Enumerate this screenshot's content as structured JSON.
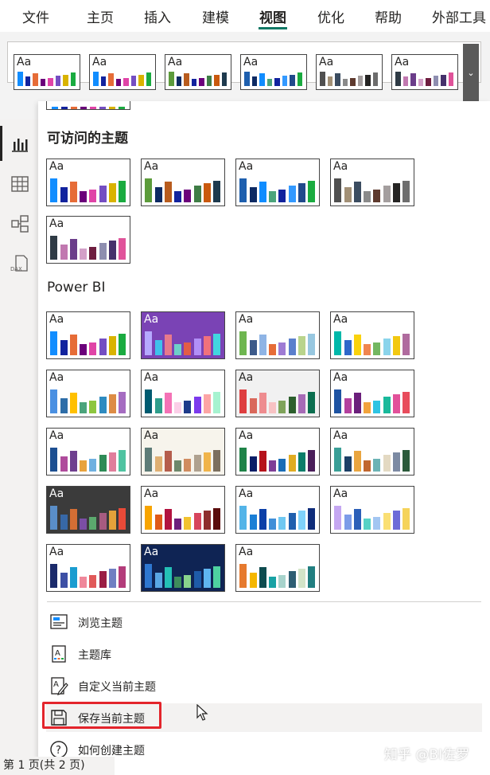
{
  "ribbon": {
    "tabs": [
      {
        "label": "文件"
      },
      {
        "label": "主页"
      },
      {
        "label": "插入"
      },
      {
        "label": "建模"
      },
      {
        "label": "视图",
        "active": true
      },
      {
        "label": "优化"
      },
      {
        "label": "帮助"
      },
      {
        "label": "外部工具"
      }
    ]
  },
  "thumb_label": "Aa",
  "accessible_section": {
    "title": "可访问的主题",
    "themes": [
      {
        "colors": [
          "#118DFF",
          "#12239E",
          "#E66C37",
          "#6B007B",
          "#E044A7",
          "#744EC2",
          "#D9B300",
          "#1AAB40"
        ],
        "bg": "#ffffff"
      },
      {
        "colors": [
          "#5C9B3B",
          "#0D2A63",
          "#B85C1E",
          "#12239E",
          "#6B007B",
          "#3F7D46",
          "#C9590E",
          "#1E3A4E"
        ],
        "bg": "#ffffff"
      },
      {
        "colors": [
          "#1E5FAE",
          "#0D2A63",
          "#118DFF",
          "#4BA47C",
          "#12239E",
          "#3399FF",
          "#214A8C",
          "#1AAB40"
        ],
        "bg": "#ffffff"
      },
      {
        "colors": [
          "#505050",
          "#A29076",
          "#3B4C60",
          "#8A8A8A",
          "#5E3A2E",
          "#A49E9E",
          "#252423",
          "#6D6D6D"
        ],
        "bg": "#ffffff"
      },
      {
        "colors": [
          "#2F3B45",
          "#C178B0",
          "#6B3D8A",
          "#D3A0C8",
          "#6E1D3F",
          "#8E8EB0",
          "#45316B",
          "#E0539A"
        ],
        "bg": "#ffffff"
      }
    ]
  },
  "powerbi_section": {
    "title": "Power BI",
    "themes": [
      {
        "colors": [
          "#118DFF",
          "#12239E",
          "#E66C37",
          "#6B007B",
          "#E044A7",
          "#744EC2",
          "#D9B300",
          "#1AAB40"
        ],
        "bg": "#ffffff"
      },
      {
        "colors": [
          "#B6A9FF",
          "#3FC1EB",
          "#E8798C",
          "#6ED0C8",
          "#E35D46",
          "#B190F7",
          "#F0717C",
          "#42D6E0"
        ],
        "bg": "#7a43b5",
        "dark": true
      },
      {
        "colors": [
          "#6EB650",
          "#3C5A8A",
          "#8FB4E5",
          "#E66C37",
          "#9E7BD4",
          "#5B7FCC",
          "#B9D48C",
          "#97C7E0"
        ],
        "bg": "#ffffff"
      },
      {
        "colors": [
          "#00B8AA",
          "#2E67CA",
          "#FAD20D",
          "#F0854F",
          "#73B761",
          "#8AD4EB",
          "#F2C811",
          "#B06B9E"
        ],
        "bg": "#ffffff"
      },
      {
        "colors": [
          "#4A90E2",
          "#2D6DA8",
          "#FFC000",
          "#4BA47C",
          "#8DC63F",
          "#2E8BC0",
          "#DD8C45",
          "#A56CC1"
        ],
        "bg": "#ffffff"
      },
      {
        "colors": [
          "#005B70",
          "#2F9E8C",
          "#F472B6",
          "#FBCFE8",
          "#1E3A8A",
          "#7C3AED",
          "#FCA5A5",
          "#A7F3D0"
        ],
        "bg": "#ffffff"
      },
      {
        "colors": [
          "#DE3E40",
          "#D9685B",
          "#EE8C8F",
          "#F7C2C3",
          "#7FA35A",
          "#2C5F2D",
          "#A66BB6",
          "#0B6E4F"
        ],
        "bg": "#f1f1f1"
      },
      {
        "colors": [
          "#1E53A2",
          "#B3409E",
          "#6B1F7B",
          "#F2A33C",
          "#2FC4E3",
          "#19B99B",
          "#E2519A",
          "#E84C5C"
        ],
        "bg": "#ffffff"
      },
      {
        "colors": [
          "#1D4F91",
          "#AF4B9C",
          "#6F3F8F",
          "#E8A33D",
          "#6FB0E0",
          "#2E8B57",
          "#E07E9B",
          "#4FC3A1"
        ],
        "bg": "#ffffff"
      },
      {
        "colors": [
          "#5D7B77",
          "#DFAF72",
          "#B55D4C",
          "#6E886B",
          "#D08C60",
          "#AFA18F",
          "#F0B44A",
          "#7C6F5F"
        ],
        "bg": "#f7f4ec"
      },
      {
        "colors": [
          "#1F8348",
          "#0B1E67",
          "#B5121B",
          "#7E3E97",
          "#1A6DB6",
          "#E0AC21",
          "#0B7D6A",
          "#4A1E5A"
        ],
        "bg": "#ffffff"
      },
      {
        "colors": [
          "#3A9F97",
          "#1C3F66",
          "#E9A540",
          "#C1672F",
          "#6CB3B5",
          "#E3D9C2",
          "#7C8AA3",
          "#2B5A3B"
        ],
        "bg": "#ffffff"
      },
      {
        "colors": [
          "#5A8EC8",
          "#3768A7",
          "#D46E34",
          "#7B4EA5",
          "#5BA96D",
          "#A75B80",
          "#E4A13A",
          "#E94A38"
        ],
        "bg": "#3b3b3b",
        "dark": true
      },
      {
        "colors": [
          "#F7A400",
          "#DF5A1A",
          "#B2123F",
          "#6D1F7C",
          "#F2C230",
          "#D7455D",
          "#8E2D2D",
          "#5B0D0D"
        ],
        "bg": "#ffffff"
      },
      {
        "colors": [
          "#53B4E8",
          "#1B7FD6",
          "#0B3FA8",
          "#3F8FD8",
          "#6FC8F2",
          "#1E5FAE",
          "#7FD2FA",
          "#0E2C7A"
        ],
        "bg": "#ffffff"
      },
      {
        "colors": [
          "#C5A7F2",
          "#7C9CE8",
          "#2B5FB8",
          "#56D2C5",
          "#A3C6F2",
          "#FADF73",
          "#6D6BD8",
          "#F5D35A"
        ],
        "bg": "#ffffff"
      },
      {
        "colors": [
          "#1B2A6B",
          "#3D50A5",
          "#1A9CD0",
          "#F0889B",
          "#E15959",
          "#9B1E45",
          "#6F7FC2",
          "#B33C7A"
        ],
        "bg": "#ffffff"
      },
      {
        "colors": [
          "#2E77D0",
          "#59A6E3",
          "#24C0B6",
          "#3E8D5B",
          "#89D38C",
          "#1E5BA8",
          "#5FB5F0",
          "#4ED1A0"
        ],
        "bg": "#0f2454",
        "dark": true
      },
      {
        "colors": [
          "#E67A2E",
          "#F5B700",
          "#0E4C4F",
          "#18A2A4",
          "#A7D3CC",
          "#2E5E73",
          "#D3E4C8",
          "#217E80"
        ],
        "bg": "#ffffff"
      }
    ]
  },
  "menu": [
    {
      "label": "浏览主题",
      "icon": "browse-theme-icon",
      "name": "browse-themes"
    },
    {
      "label": "主题库",
      "icon": "theme-gallery-icon",
      "name": "theme-gallery"
    },
    {
      "label": "自定义当前主题",
      "icon": "customize-theme-icon",
      "name": "customize-theme"
    },
    {
      "label": "保存当前主题",
      "icon": "save-icon",
      "name": "save-current-theme"
    },
    {
      "label": "如何创建主题",
      "icon": "help-icon",
      "name": "how-to-create-theme"
    }
  ],
  "status": {
    "text": "第 1 页(共 2 页)"
  },
  "watermark": "知乎 @BI佐罗",
  "colors": {
    "accent": "#117865",
    "highlight": "#e3242b"
  }
}
